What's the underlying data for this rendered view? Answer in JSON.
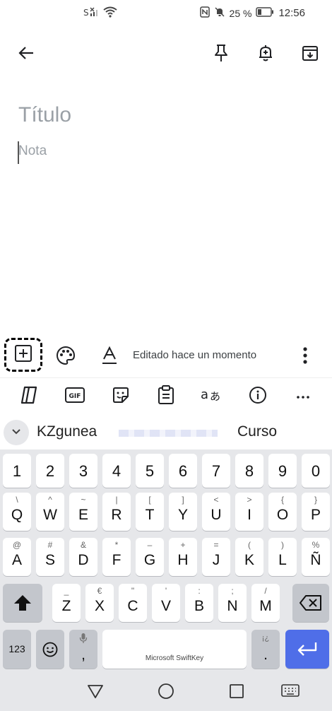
{
  "status": {
    "left_icons": [
      "sim-no-signal-icon",
      "wifi-icon"
    ],
    "nfc": "N",
    "battery_percent": "25 %",
    "time": "12:56"
  },
  "appbar": {
    "back_icon": "arrow-left-icon",
    "pin_icon": "pin-icon",
    "reminder_icon": "bell-plus-icon",
    "archive_icon": "archive-icon"
  },
  "note": {
    "title_placeholder": "Título",
    "body_placeholder": "Nota"
  },
  "bottombar": {
    "edited_text": "Editado hace un momento"
  },
  "keyboard_toolbar": {
    "items": [
      "copilot-icon",
      "GIF",
      "sticker-icon",
      "clipboard-icon",
      "translate-icon",
      "info-icon",
      "···"
    ]
  },
  "suggestions": {
    "first": "KZgunea",
    "third": "Curso"
  },
  "keys": {
    "numbers": [
      "1",
      "2",
      "3",
      "4",
      "5",
      "6",
      "7",
      "8",
      "9",
      "0"
    ],
    "row1": [
      {
        "sub": "\\",
        "main": "Q"
      },
      {
        "sub": "^",
        "main": "W"
      },
      {
        "sub": "~",
        "main": "E"
      },
      {
        "sub": "|",
        "main": "R"
      },
      {
        "sub": "[",
        "main": "T"
      },
      {
        "sub": "]",
        "main": "Y"
      },
      {
        "sub": "<",
        "main": "U"
      },
      {
        "sub": ">",
        "main": "I"
      },
      {
        "sub": "{",
        "main": "O"
      },
      {
        "sub": "}",
        "main": "P"
      }
    ],
    "row2": [
      {
        "sub": "@",
        "main": "A"
      },
      {
        "sub": "#",
        "main": "S"
      },
      {
        "sub": "&",
        "main": "D"
      },
      {
        "sub": "*",
        "main": "F"
      },
      {
        "sub": "–",
        "main": "G"
      },
      {
        "sub": "+",
        "main": "H"
      },
      {
        "sub": "=",
        "main": "J"
      },
      {
        "sub": "(",
        "main": "K"
      },
      {
        "sub": ")",
        "main": "L"
      },
      {
        "sub": "%",
        "main": "Ñ"
      }
    ],
    "row3": [
      {
        "sub": "_",
        "main": "Z"
      },
      {
        "sub": "€",
        "main": "X"
      },
      {
        "sub": "\"",
        "main": "C"
      },
      {
        "sub": "'",
        "main": "V"
      },
      {
        "sub": ":",
        "main": "B"
      },
      {
        "sub": ";",
        "main": "N"
      },
      {
        "sub": "/",
        "main": "M"
      }
    ],
    "sym": "123",
    "comma": ",",
    "space": "Microsoft SwiftKey",
    "period": ".",
    "period_sub": "¡¿"
  },
  "colors": {
    "accent_enter": "#4f6ee8",
    "keyboard_bg": "#e6e7ea"
  }
}
